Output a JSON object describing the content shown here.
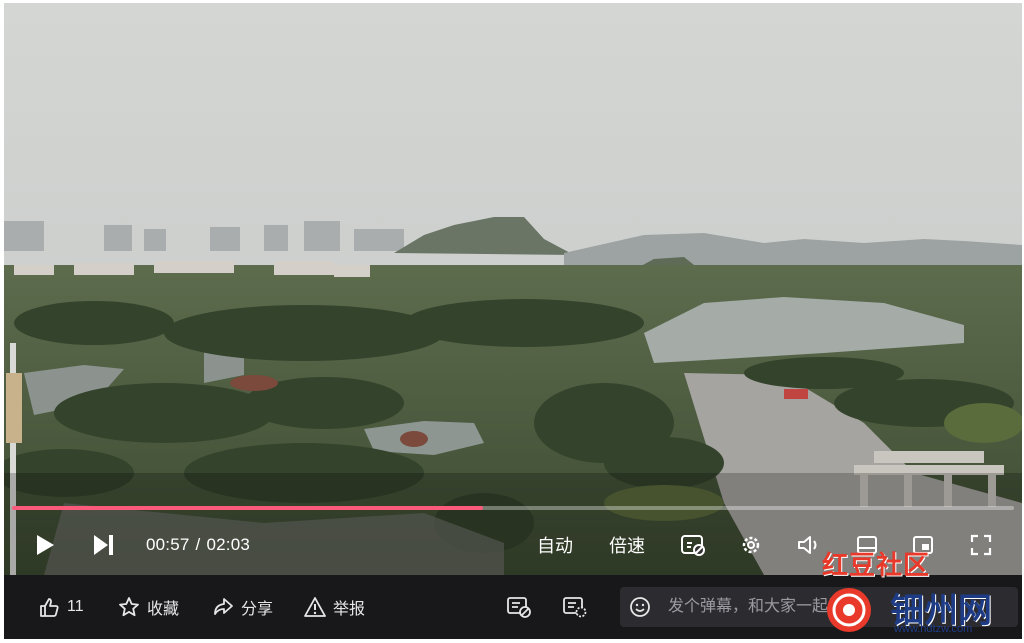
{
  "player": {
    "progress_fraction": 0.47,
    "current_time": "00:57",
    "time_separator": "/",
    "duration": "02:03",
    "quality_label": "自动",
    "speed_label": "倍速",
    "colors": {
      "progress": "#fb5a7a",
      "bar_bg": "#18181b"
    }
  },
  "actions": {
    "like_count": "11",
    "collect_label": "收藏",
    "share_label": "分享",
    "report_label": "举报"
  },
  "danmaku": {
    "placeholder": "发个弹幕，和大家一起讨论"
  },
  "watermark": {
    "top_text": "红豆社区",
    "main_text": "钿州网",
    "url_text": "www.hdtzw.com"
  }
}
